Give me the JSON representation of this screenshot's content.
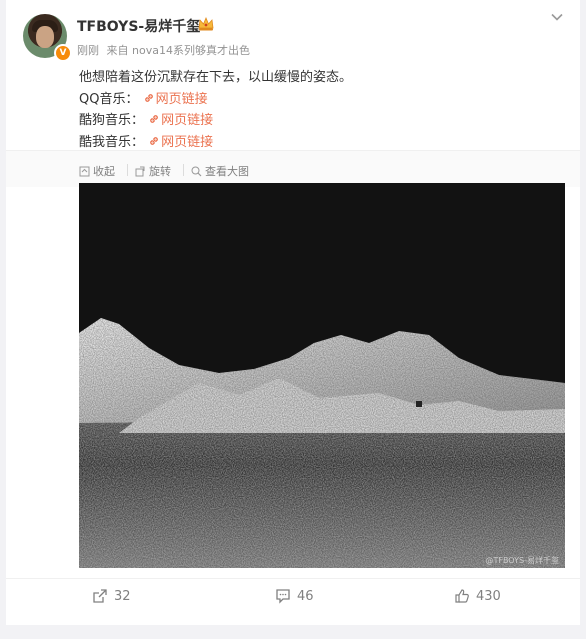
{
  "post": {
    "author": "TFBOYS-易烊千玺",
    "time": "刚刚",
    "source": "来自 nova14系列够真才出色",
    "text": "他想陪着这份沉默存在下去，以山缓慢的姿态。",
    "links": [
      {
        "platform": "QQ音乐：",
        "label": "网页链接"
      },
      {
        "platform": "酷狗音乐：",
        "label": "网页链接"
      },
      {
        "platform": "酷我音乐：",
        "label": "网页链接"
      }
    ]
  },
  "toolbar": {
    "collapse": "收起",
    "rotate": "旋转",
    "view_large": "查看大图"
  },
  "image": {
    "watermark": "@TFBOYS-易烊千玺"
  },
  "actions": {
    "reposts": "32",
    "comments": "46",
    "likes": "430"
  },
  "colors": {
    "link": "#eb7350",
    "meta": "#939393",
    "badge": "#f78b0b",
    "background": "#f2f2f5"
  }
}
